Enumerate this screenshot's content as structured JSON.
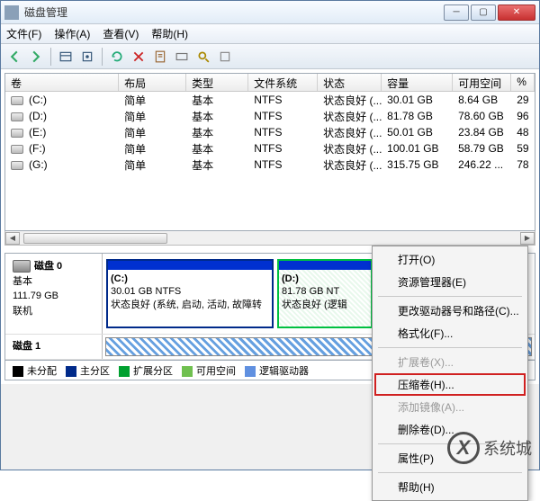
{
  "window": {
    "title": "磁盘管理"
  },
  "menu": {
    "file": "文件(F)",
    "action": "操作(A)",
    "view": "查看(V)",
    "help": "帮助(H)"
  },
  "columns": {
    "vol": "卷",
    "layout": "布局",
    "type": "类型",
    "fs": "文件系统",
    "status": "状态",
    "cap": "容量",
    "free": "可用空间",
    "pct": "%"
  },
  "volumes": [
    {
      "name": "(C:)",
      "layout": "简单",
      "type": "基本",
      "fs": "NTFS",
      "status": "状态良好 (...",
      "cap": "30.01 GB",
      "free": "8.64 GB",
      "pct": "29"
    },
    {
      "name": "(D:)",
      "layout": "简单",
      "type": "基本",
      "fs": "NTFS",
      "status": "状态良好 (...",
      "cap": "81.78 GB",
      "free": "78.60 GB",
      "pct": "96"
    },
    {
      "name": "(E:)",
      "layout": "简单",
      "type": "基本",
      "fs": "NTFS",
      "status": "状态良好 (...",
      "cap": "50.01 GB",
      "free": "23.84 GB",
      "pct": "48"
    },
    {
      "name": "(F:)",
      "layout": "简单",
      "type": "基本",
      "fs": "NTFS",
      "status": "状态良好 (...",
      "cap": "100.01 GB",
      "free": "58.79 GB",
      "pct": "59"
    },
    {
      "name": "(G:)",
      "layout": "简单",
      "type": "基本",
      "fs": "NTFS",
      "status": "状态良好 (...",
      "cap": "315.75 GB",
      "free": "246.22 ...",
      "pct": "78"
    }
  ],
  "disk0": {
    "title": "磁盘 0",
    "type": "基本",
    "size": "111.79 GB",
    "status": "联机",
    "partC": {
      "label": "(C:)",
      "size": "30.01 GB NTFS",
      "status": "状态良好 (系统, 启动, 活动, 故障转"
    },
    "partD": {
      "label": "(D:)",
      "size": "81.78 GB NT",
      "status": "状态良好 (逻辑"
    }
  },
  "disk1": {
    "title": "磁盘 1"
  },
  "legend": {
    "unalloc": "未分配",
    "primary": "主分区",
    "ext": "扩展分区",
    "free": "可用空间",
    "logical": "逻辑驱动器"
  },
  "ctx": {
    "open": "打开(O)",
    "explorer": "资源管理器(E)",
    "changeletter": "更改驱动器号和路径(C)...",
    "format": "格式化(F)...",
    "extend": "扩展卷(X)...",
    "shrink": "压缩卷(H)...",
    "mirror": "添加镜像(A)...",
    "delete": "删除卷(D)...",
    "props": "属性(P)",
    "help": "帮助(H)"
  },
  "watermark": "系统城"
}
